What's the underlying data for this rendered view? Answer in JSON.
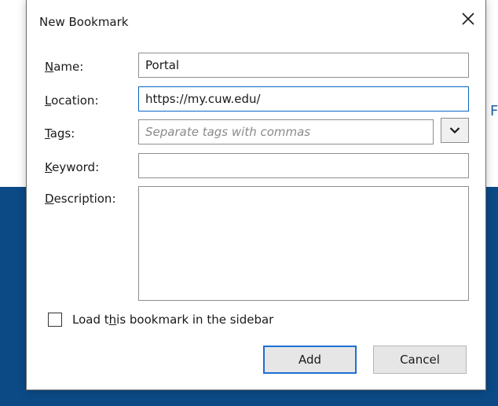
{
  "dialog": {
    "title": "New Bookmark",
    "labels": {
      "name": "Name:",
      "location": "Location:",
      "tags": "Tags:",
      "keyword": "Keyword:",
      "description": "Description:"
    },
    "fields": {
      "name_value": "Portal",
      "location_value": "https://my.cuw.edu/",
      "tags_placeholder": "Separate tags with commas",
      "keyword_value": "",
      "description_value": ""
    },
    "checkbox_label": "Load this bookmark in the sidebar",
    "checkbox_checked": false,
    "buttons": {
      "add": "Add",
      "cancel": "Cancel"
    }
  },
  "background": {
    "partial_text": "F"
  },
  "colors": {
    "background_blue": "#0c4a86",
    "focus_border": "#0a66c2",
    "primary_button_border": "#1f6ed4"
  },
  "icons": {
    "close": "close-icon",
    "dropdown": "chevron-down-icon"
  }
}
